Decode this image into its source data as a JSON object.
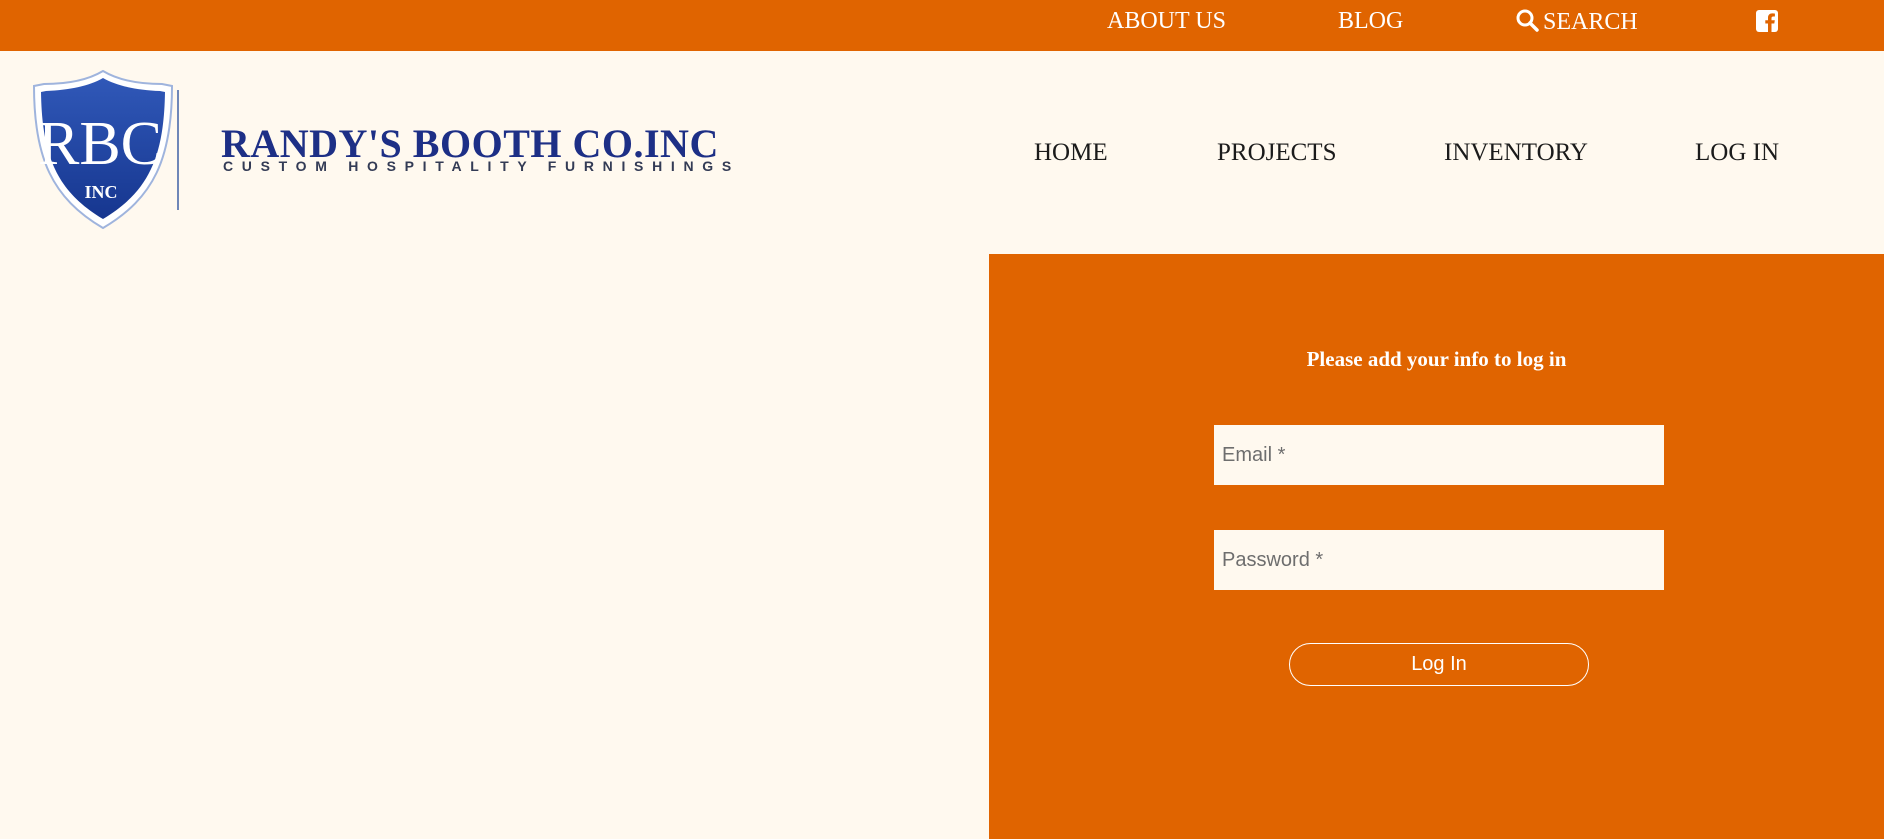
{
  "colors": {
    "accent": "#e06400",
    "background": "#fff9ef",
    "brand_blue": "#1d2f86"
  },
  "topbar": {
    "about": "ABOUT US",
    "blog": "BLOG",
    "search": "SEARCH",
    "search_icon": "search-icon",
    "facebook_icon": "facebook-icon"
  },
  "logo": {
    "monogram": "RBC",
    "monogram_sub": "INC",
    "name": "RANDY'S BOOTH CO.INC",
    "tagline": "CUSTOM HOSPITALITY FURNISHINGS"
  },
  "nav": {
    "home": "HOME",
    "projects": "PROJECTS",
    "inventory": "INVENTORY",
    "login": "LOG IN"
  },
  "login_form": {
    "title": "Please add your info to log in",
    "email_placeholder": "Email *",
    "password_placeholder": "Password *",
    "submit_label": "Log In"
  }
}
